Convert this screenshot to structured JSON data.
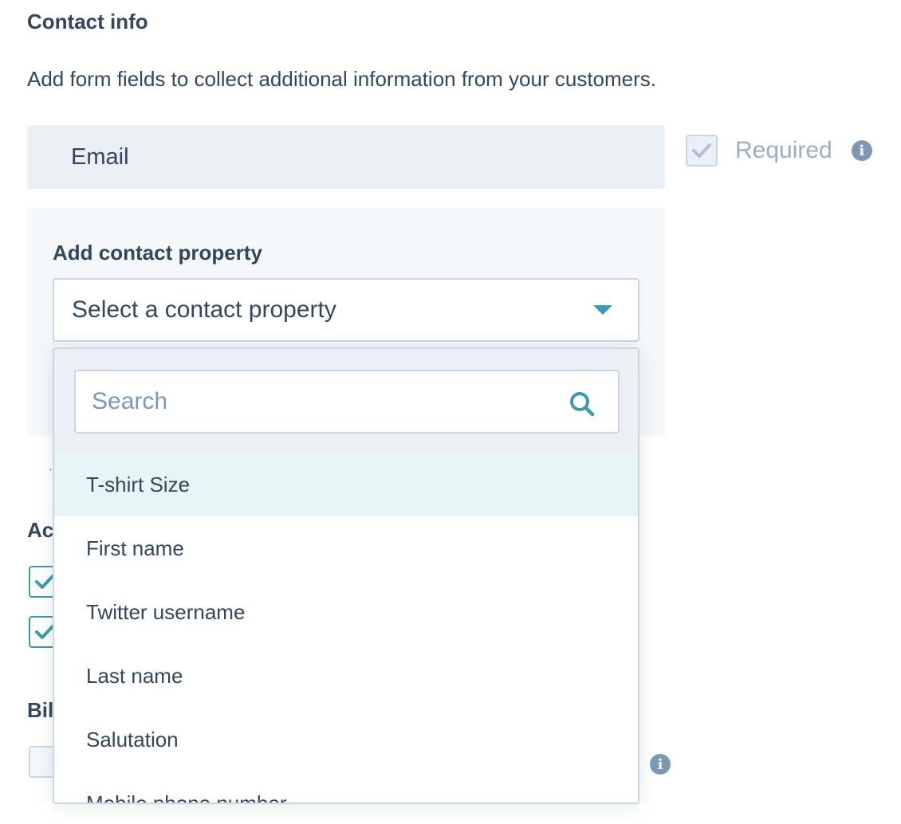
{
  "section": {
    "title": "Contact info",
    "description": "Add form fields to collect additional information from your customers."
  },
  "email_field": {
    "label": "Email",
    "required_label": "Required",
    "required_checked": true
  },
  "property_picker": {
    "label": "Add contact property",
    "select_placeholder": "Select a contact property"
  },
  "dropdown": {
    "search_placeholder": "Search",
    "options": [
      {
        "label": "T-shirt Size",
        "highlighted": true
      },
      {
        "label": "First name",
        "highlighted": false
      },
      {
        "label": "Twitter username",
        "highlighted": false
      },
      {
        "label": "Last name",
        "highlighted": false
      },
      {
        "label": "Salutation",
        "highlighted": false
      },
      {
        "label": "Mobile phone number",
        "highlighted": false
      }
    ]
  },
  "background_partial": {
    "dot": "·",
    "heading_1": "Ac",
    "heading_2": "Bil"
  },
  "colors": {
    "text": "#33475b",
    "accent": "#3e9aad",
    "muted": "#7c98b6",
    "field_bg": "#eaf0f6",
    "highlight": "#e5f5f8"
  },
  "icons": {
    "required_checkbox": "checkmark-icon",
    "info": "info-icon",
    "select_caret": "caret-down-icon",
    "search": "search-icon"
  }
}
